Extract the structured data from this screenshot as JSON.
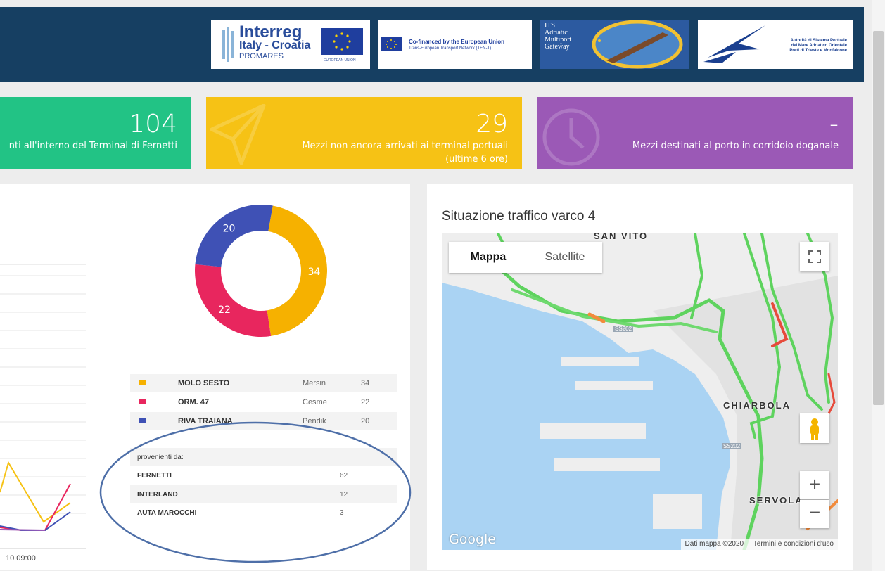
{
  "header": {
    "logos": [
      {
        "name": "Interreg Italy - Croatia",
        "text_main": "Interreg",
        "text_sub": "Italy - Croatia",
        "text_small": "PROMARES",
        "flag_caption": "EUROPEAN UNION"
      },
      {
        "name": "Co-financed by the European Union",
        "line1": "Co-financed by the European Union",
        "line2": "Trans-European Transport Network (TEN-T)"
      },
      {
        "name": "ITS Adriatic Multiport Gateway",
        "line1": "ITS",
        "line2": "Adriatic",
        "line3": "Multiport",
        "line4": "Gateway"
      },
      {
        "name": "Autorità di Sistema Portuale",
        "line1": "Autorità di Sistema Portuale",
        "line2": "del Mare Adriatico Orientale",
        "line3": "Porti di Trieste e Monfalcone"
      }
    ]
  },
  "cards": [
    {
      "value": "104",
      "label": "nti all'interno del Terminal di Fernetti",
      "color": "#22c385",
      "icon": "truck-icon"
    },
    {
      "value": "29",
      "label_line1": "Mezzi non ancora arrivati ai terminal portuali",
      "label_line2": "(ultime 6 ore)",
      "color": "#f6c215",
      "icon": "paper-plane-icon"
    },
    {
      "value": "-",
      "label": "Mezzi destinati al porto in corridoio doganale",
      "color": "#9b59b6",
      "icon": "clock-icon"
    }
  ],
  "chart_data": {
    "type": "pie",
    "donut": true,
    "labels": [
      "MOLO SESTO",
      "ORM. 47",
      "RIVA TRAIANA"
    ],
    "values": [
      34,
      22,
      20
    ],
    "colors": [
      "#f6b100",
      "#e8265e",
      "#3f51b5"
    ]
  },
  "legend_rows": [
    {
      "name": "MOLO SESTO",
      "source": "Mersin",
      "value": "34",
      "color": "#f6b100"
    },
    {
      "name": "ORM. 47",
      "source": "Cesme",
      "value": "22",
      "color": "#e8265e"
    },
    {
      "name": "RIVA TRAIANA",
      "source": "Pendik",
      "value": "20",
      "color": "#3f51b5"
    }
  ],
  "provenance": {
    "heading": "provenienti da:",
    "rows": [
      {
        "name": "FERNETTI",
        "value": "62"
      },
      {
        "name": "INTERLAND",
        "value": "12"
      },
      {
        "name": "AUTA MAROCCHI",
        "value": "3"
      }
    ]
  },
  "line_chart": {
    "x_label": "10 09:00",
    "series_colors": [
      "#f6c215",
      "#e8265e",
      "#3f51b5",
      "#9b59b6"
    ]
  },
  "map": {
    "title": "Situazione traffico varco 4",
    "tab_map": "Mappa",
    "tab_satellite": "Satellite",
    "places": [
      "SAN VITO",
      "CHIARBOLA",
      "SERVOLA"
    ],
    "road_labels": [
      "SS202",
      "SS202"
    ],
    "attribution": "Google",
    "footer_data": "Dati mappa ©2020",
    "footer_terms": "Termini e condizioni d'uso",
    "zoom_in": "+",
    "zoom_out": "−"
  }
}
